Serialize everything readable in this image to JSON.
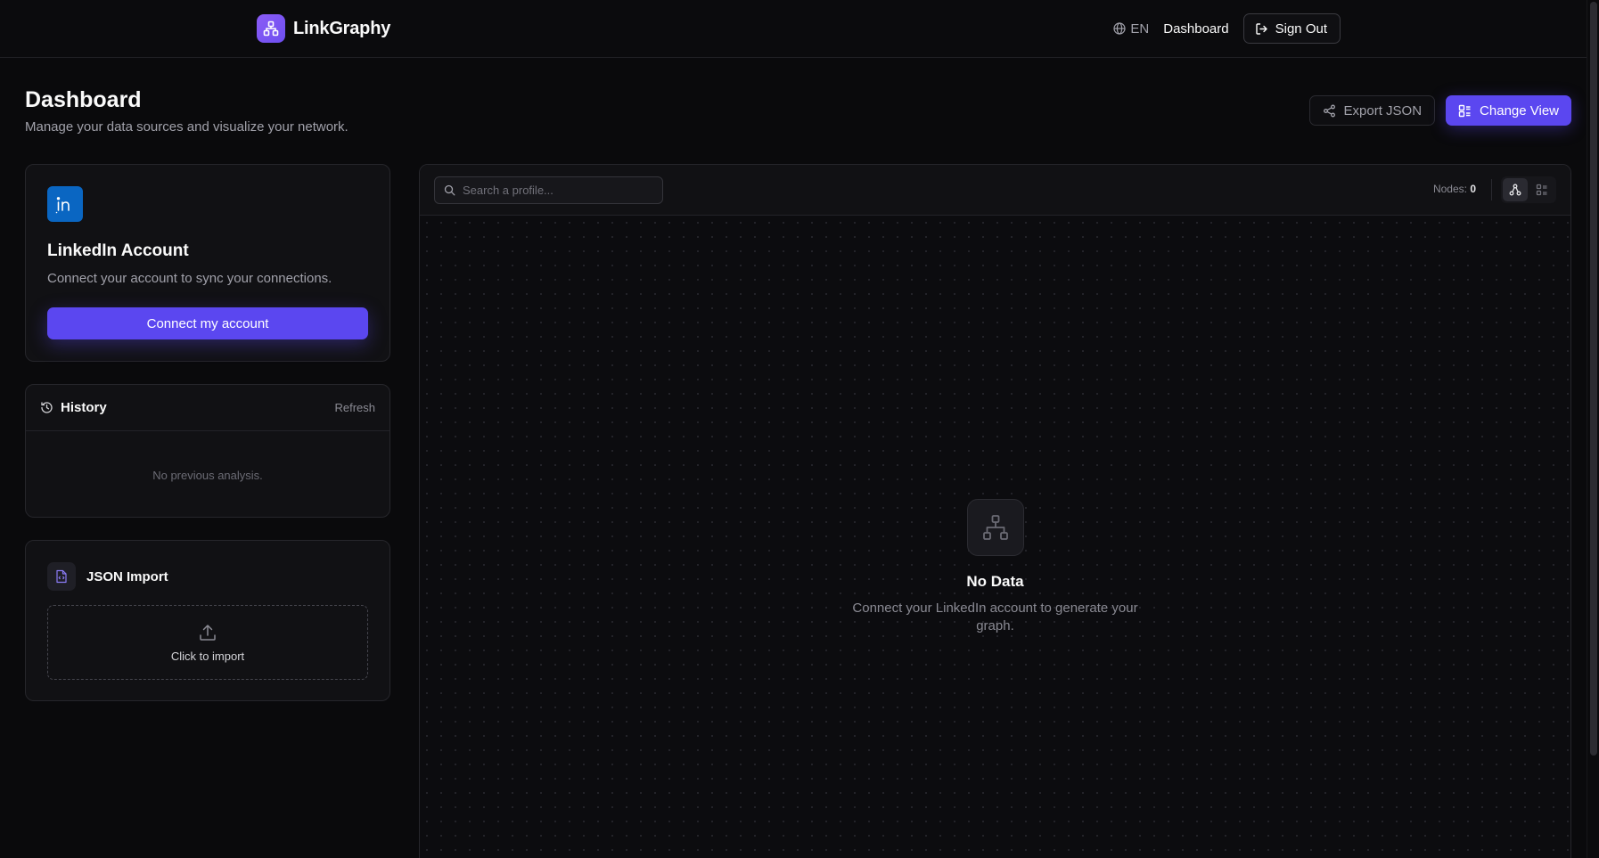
{
  "header": {
    "brand": "LinkGraphy",
    "language": "EN",
    "nav_dashboard": "Dashboard",
    "sign_out": "Sign Out"
  },
  "page": {
    "title": "Dashboard",
    "subtitle": "Manage your data sources and visualize your network.",
    "export_label": "Export JSON",
    "change_view_label": "Change View"
  },
  "linkedin_card": {
    "title": "LinkedIn Account",
    "description": "Connect your account to sync your connections.",
    "button": "Connect my account"
  },
  "history_card": {
    "title": "History",
    "refresh": "Refresh",
    "empty": "No previous analysis."
  },
  "json_card": {
    "title": "JSON Import",
    "dropzone": "Click to import"
  },
  "graph": {
    "search_placeholder": "Search a profile...",
    "nodes_label": "Nodes:",
    "nodes_count": "0",
    "empty_title": "No Data",
    "empty_desc": "Connect your LinkedIn account to generate your graph."
  },
  "colors": {
    "accent": "#5b47f0",
    "linkedin": "#0a66c2",
    "background": "#0a0a0c"
  },
  "icons": [
    "network-icon",
    "globe-icon",
    "sign-out-icon",
    "share-icon",
    "layout-icon",
    "linkedin-icon",
    "history-icon",
    "file-code-icon",
    "upload-icon",
    "search-icon",
    "graph-view-icon",
    "list-view-icon"
  ]
}
